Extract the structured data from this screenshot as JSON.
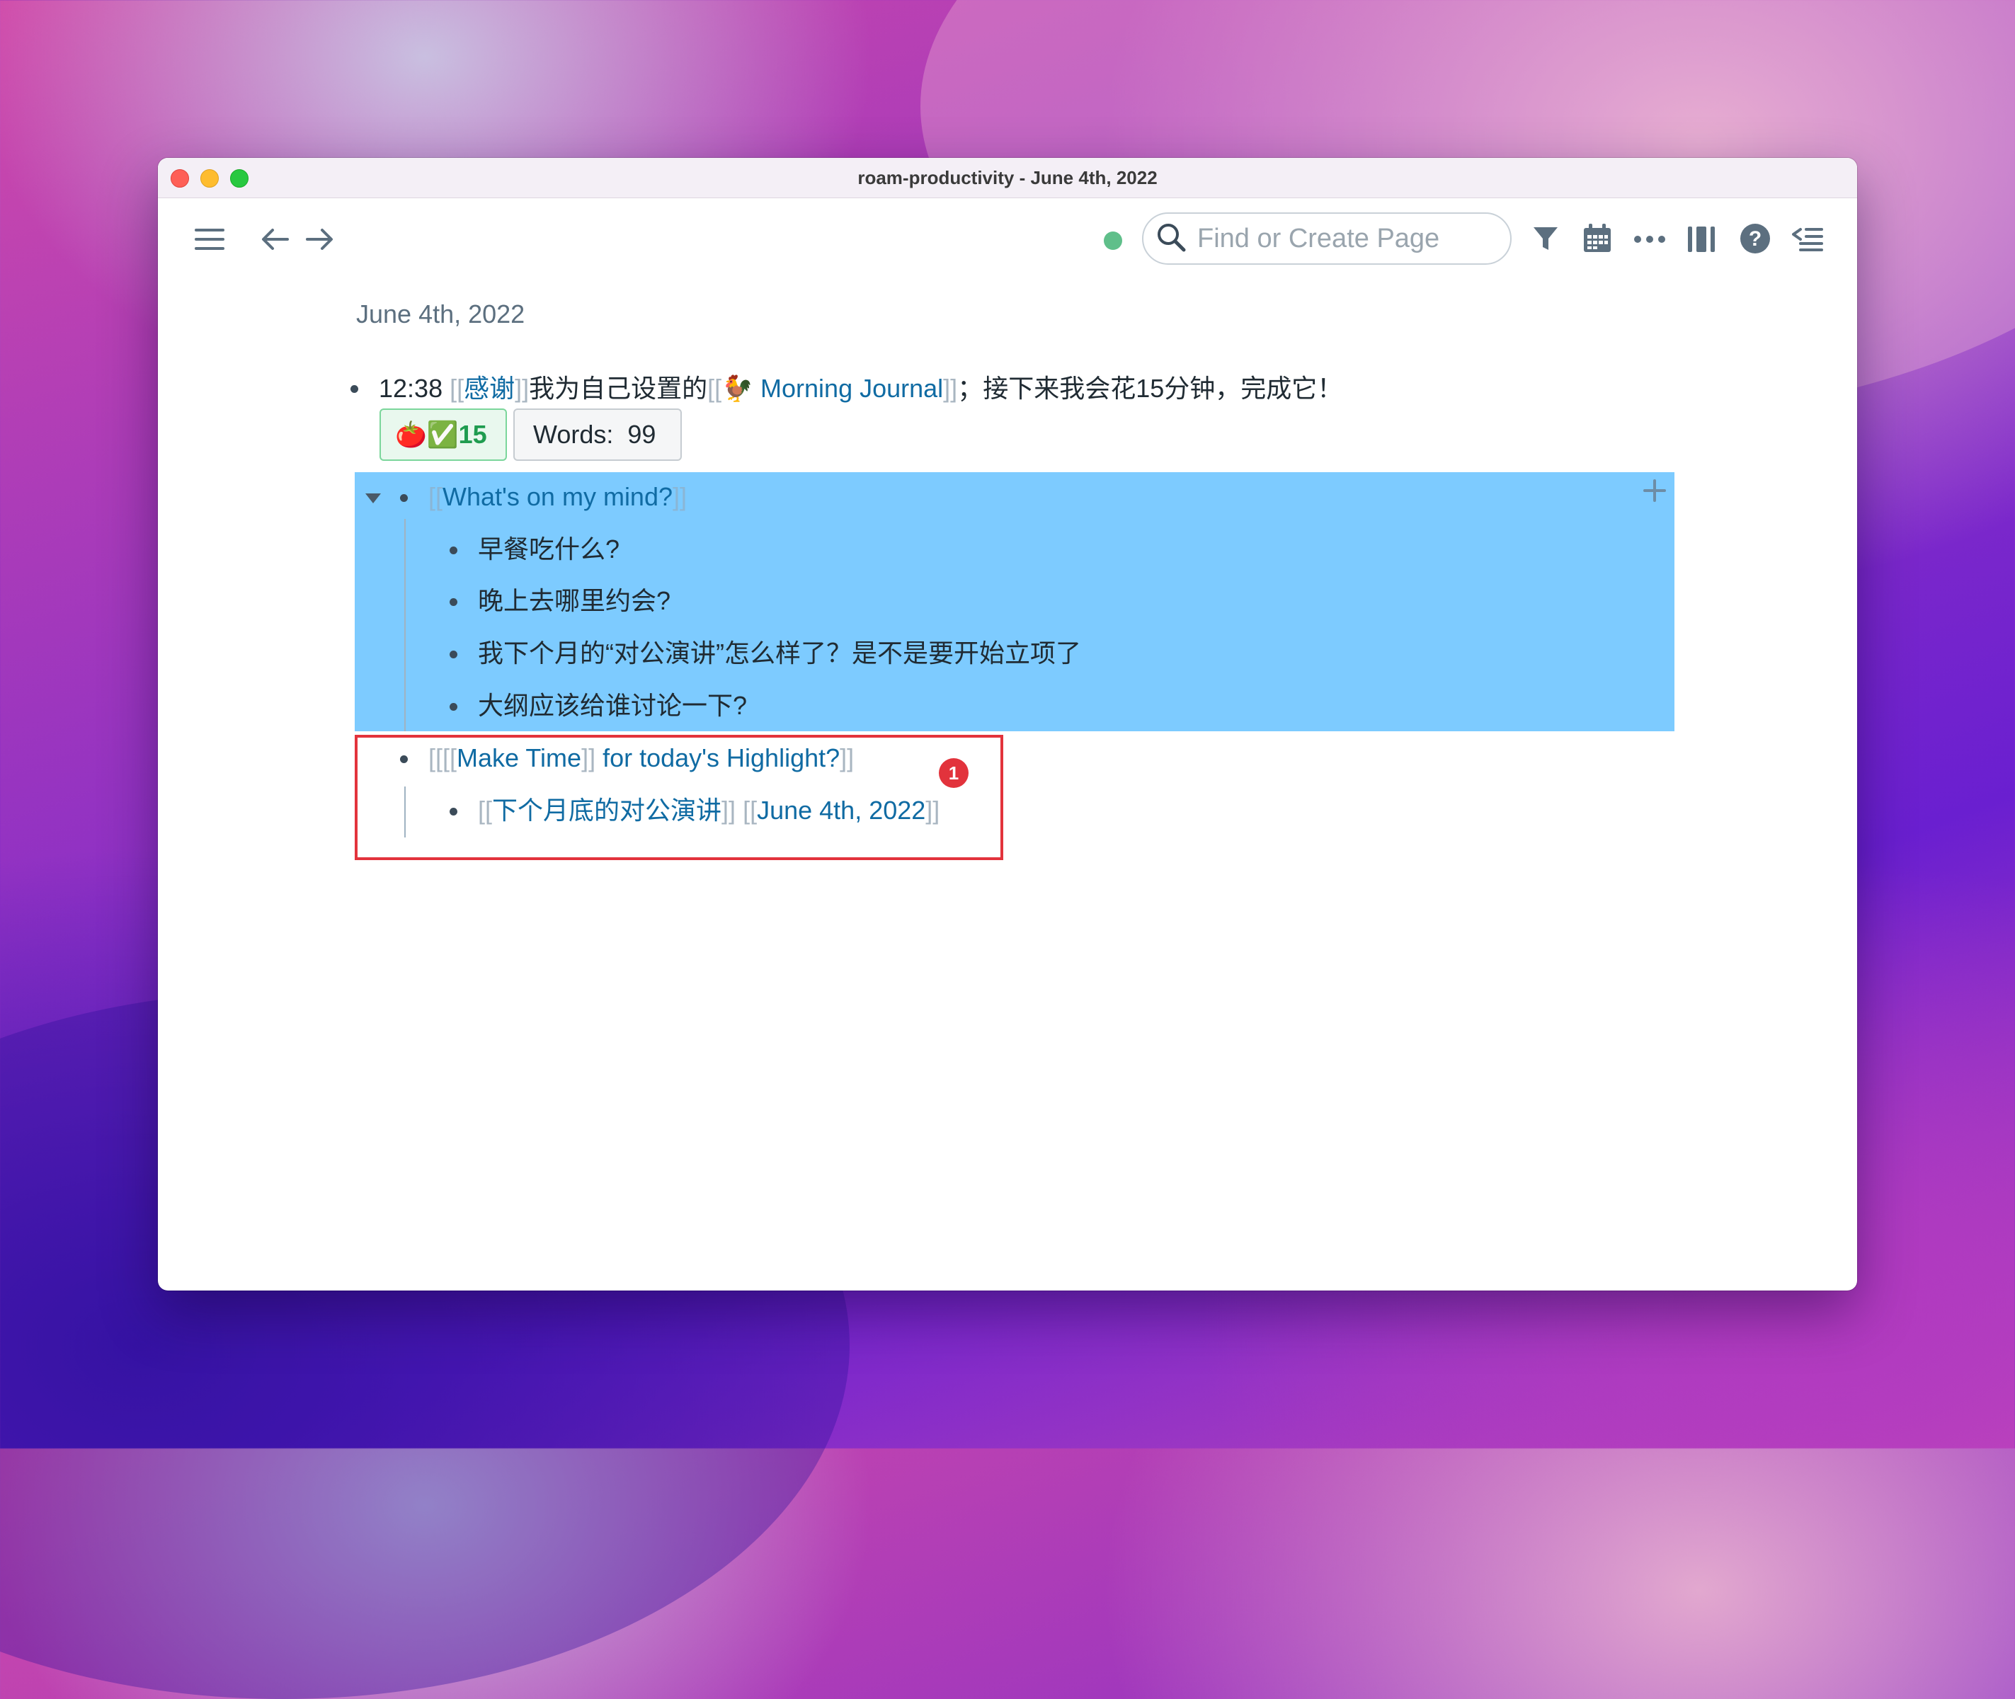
{
  "window": {
    "title": "roam-productivity - June 4th, 2022"
  },
  "toolbar": {
    "search_placeholder": "Find or Create Page"
  },
  "page": {
    "title": "June 4th, 2022",
    "block1": {
      "time": "12:38",
      "link1": "感谢",
      "text1": "我为自己设置的",
      "link2_emoji": "🐓",
      "link2": "Morning Journal",
      "text2": "；接下来我会花15分钟，完成它！"
    },
    "chips": {
      "pomodoro": "🍅✅15",
      "words_label": "Words:",
      "words_value": "99"
    },
    "block2": {
      "heading": "What's on my mind?",
      "children": [
        "早餐吃什么?",
        "晚上去哪里约会?",
        "我下个月的“对公演讲”怎么样了？是不是要开始立项了",
        "大纲应该给谁讨论一下?"
      ]
    },
    "block3": {
      "link_inner": "Make Time",
      "heading_rest": " for today's Highlight?",
      "child_link1": "下个月底的对公演讲",
      "child_link2": "June 4th, 2022"
    },
    "badge": "1"
  },
  "colors": {
    "selection": "#7dcbff",
    "link": "#106ba3",
    "bracket": "#a9b6c1",
    "annotation_red": "#e2333c"
  }
}
